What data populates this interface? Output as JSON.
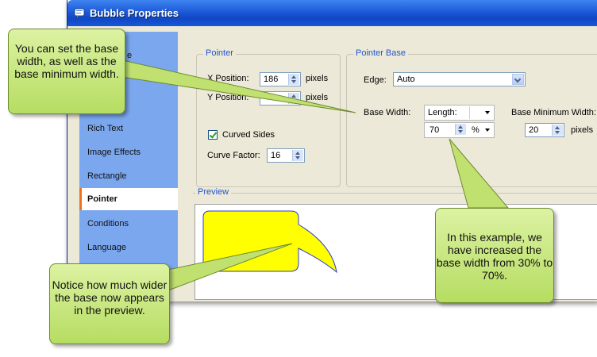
{
  "window": {
    "title": "Bubble Properties"
  },
  "nav": {
    "items": [
      {
        "label": "Rich Text"
      },
      {
        "label": "Image Effects"
      },
      {
        "label": "Rectangle"
      },
      {
        "label": "Pointer",
        "selected": true
      },
      {
        "label": "Conditions"
      },
      {
        "label": "Language"
      }
    ],
    "partial_label": "e"
  },
  "pointer_group": {
    "legend": "Pointer",
    "x_label": "X Position:",
    "x_value": "186",
    "x_unit": "pixels",
    "y_label": "Y Position:",
    "y_unit": "pixels",
    "curved_label": "Curved Sides",
    "curved_checked": true,
    "curve_factor_label": "Curve Factor:",
    "curve_factor_value": "16"
  },
  "pointer_base_group": {
    "legend": "Pointer Base",
    "edge_label": "Edge:",
    "edge_value": "Auto",
    "base_width_label": "Base Width:",
    "base_width_mode": "Length:",
    "base_width_value": "70",
    "base_width_unit": "%",
    "base_min_label": "Base Minimum Width:",
    "base_min_value": "20",
    "base_min_unit": "pixels"
  },
  "preview": {
    "legend": "Preview"
  },
  "callouts": {
    "top_left": "You can set the base width, as well as the base minimum width.",
    "right": "In this example, we have increased the base width from 30% to 70%.",
    "bottom": "Notice how much wider the base now appears in the preview."
  },
  "colors": {
    "titlebar": "#1d5ad8",
    "nav_bg": "#7ba7ef",
    "callout_fill": "#c8e882",
    "bubble_fill": "#ffff00",
    "legend_text": "#2255cc"
  }
}
